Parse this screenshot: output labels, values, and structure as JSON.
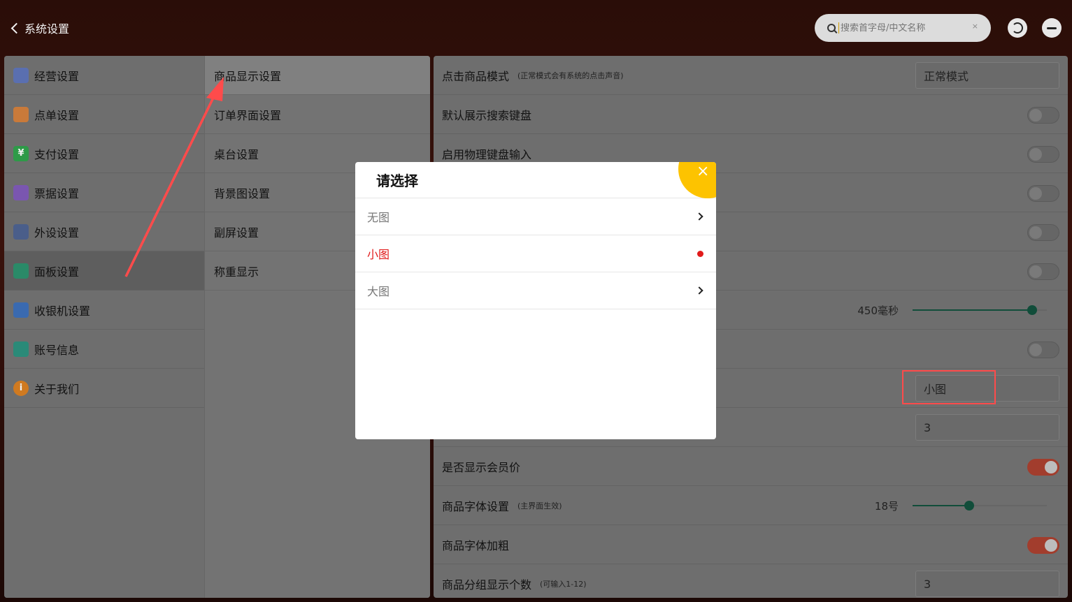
{
  "header": {
    "back_label": "系统设置",
    "search_placeholder": "搜索首字母/中文名称",
    "clear_label": "×"
  },
  "sidebar": {
    "items": [
      {
        "label": "经营设置",
        "icon": "store-icon",
        "color": "#5a6fb0"
      },
      {
        "label": "点单设置",
        "icon": "order-icon",
        "color": "#c97a3a"
      },
      {
        "label": "支付设置",
        "icon": "yen-icon",
        "color": "#2e9a48"
      },
      {
        "label": "票据设置",
        "icon": "printer-icon",
        "color": "#7a56b0"
      },
      {
        "label": "外设设置",
        "icon": "device-icon",
        "color": "#4a5e8a"
      },
      {
        "label": "面板设置",
        "icon": "panel-icon",
        "color": "#2a8a68"
      },
      {
        "label": "收银机设置",
        "icon": "cashier-icon",
        "color": "#3a6ab0"
      },
      {
        "label": "账号信息",
        "icon": "account-icon",
        "color": "#2a8a78"
      },
      {
        "label": "关于我们",
        "icon": "info-icon",
        "color": "#d07a20"
      }
    ]
  },
  "subnav": {
    "items": [
      "商品显示设置",
      "订单界面设置",
      "桌台设置",
      "背景图设置",
      "副屏设置",
      "称重显示"
    ]
  },
  "settings": {
    "click_mode": {
      "label": "点击商品模式",
      "hint": "(正常模式会有系统的点击声音)",
      "value": "正常模式"
    },
    "show_keyboard": {
      "label": "默认展示搜索键盘"
    },
    "physical_keyboard": {
      "label": "启用物理键盘输入"
    },
    "slider_ms": {
      "value_label": "450毫秒",
      "fraction": 0.89
    },
    "image_size": {
      "value": "小图"
    },
    "columns": {
      "value": "3"
    },
    "member_price": {
      "label": "是否显示会员价"
    },
    "font_setting": {
      "label": "商品字体设置",
      "hint": "(主界面生效)",
      "value_label": "18号",
      "fraction": 0.42
    },
    "font_bold": {
      "label": "商品字体加粗"
    },
    "group_count": {
      "label": "商品分组显示个数",
      "hint": "(可输入1-12)",
      "value": "3"
    }
  },
  "modal": {
    "title": "请选择",
    "close_label": "×",
    "options": [
      {
        "label": "无图",
        "selected": false
      },
      {
        "label": "小图",
        "selected": true
      },
      {
        "label": "大图",
        "selected": false
      }
    ]
  },
  "colors": {
    "accent": "#fdc300",
    "selected": "#e11b1b",
    "annotation": "#ff4b4b"
  }
}
